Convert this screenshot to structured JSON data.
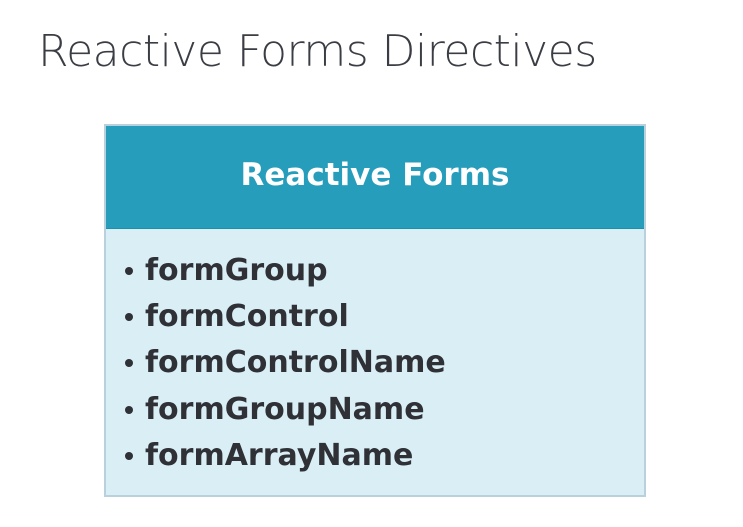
{
  "slide": {
    "title": "Reactive Forms Directives"
  },
  "card": {
    "header": "Reactive Forms",
    "items": [
      "formGroup",
      "formControl",
      "formControlName",
      "formGroupName",
      "formArrayName"
    ],
    "colors": {
      "header_bg": "#279dbc",
      "body_bg": "#d9eff5",
      "text": "#2f3137"
    }
  }
}
